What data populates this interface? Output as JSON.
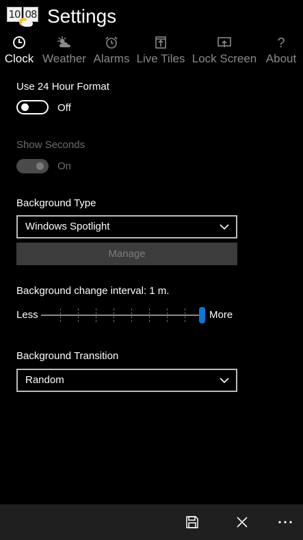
{
  "app": {
    "title": "Settings",
    "icon_digits": [
      "10",
      "08"
    ],
    "accent_color": "#0a78d7"
  },
  "tabs": [
    {
      "label": "Clock",
      "icon": "clock-icon",
      "active": true
    },
    {
      "label": "Weather",
      "icon": "weather-icon",
      "active": false
    },
    {
      "label": "Alarms",
      "icon": "alarm-icon",
      "active": false
    },
    {
      "label": "Live Tiles",
      "icon": "live-tiles-icon",
      "active": false
    },
    {
      "label": "Lock Screen",
      "icon": "lock-screen-icon",
      "active": false
    },
    {
      "label": "About",
      "icon": "about-icon",
      "active": false
    }
  ],
  "settings": {
    "use24": {
      "label": "Use 24 Hour Format",
      "state": "Off"
    },
    "showSeconds": {
      "label": "Show Seconds",
      "state": "On"
    },
    "backgroundType": {
      "label": "Background Type",
      "value": "Windows Spotlight",
      "manage_label": "Manage"
    },
    "interval": {
      "label": "Background change interval: 1 m.",
      "less_label": "Less",
      "more_label": "More",
      "level": 1.0
    },
    "transition": {
      "label": "Background Transition",
      "value": "Random"
    }
  },
  "appbar": {
    "buttons": [
      {
        "name": "save-icon"
      },
      {
        "name": "close-icon"
      },
      {
        "name": "more-icon"
      }
    ]
  }
}
